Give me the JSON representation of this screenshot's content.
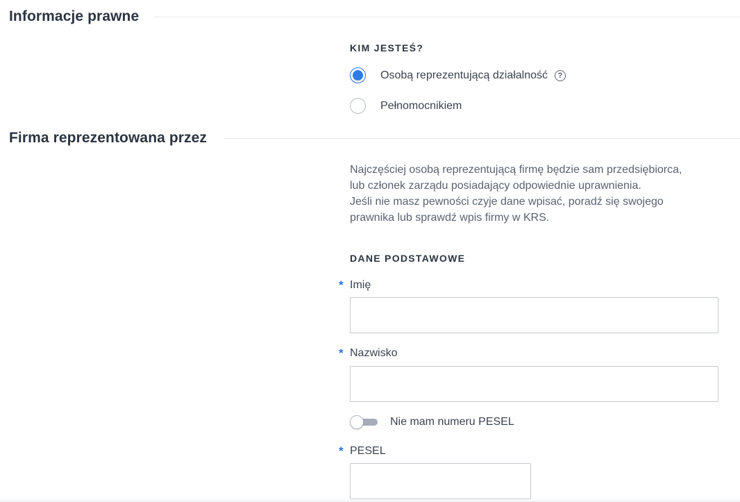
{
  "sections": {
    "legal_info_title": "Informacje prawne",
    "company_represented_title": "Firma reprezentowana przez"
  },
  "who_are_you": {
    "label": "KIM JESTEŚ?",
    "options": [
      {
        "label": "Osobą reprezentującą działalność",
        "checked": true,
        "help_icon": "question-circle-icon"
      },
      {
        "label": "Pełnomocnikiem",
        "checked": false
      }
    ]
  },
  "info_text": {
    "lines": [
      "Najczęściej osobą reprezentującą firmę będzie sam przedsiębiorca,",
      "lub członek zarządu posiadający odpowiednie uprawnienia.",
      "Jeśli nie masz pewności czyje dane wpisać, poradź się swojego",
      "prawnika lub sprawdź wpis firmy w KRS."
    ]
  },
  "basic_data": {
    "label": "DANE PODSTAWOWE",
    "required_marker": "*",
    "first_name": {
      "label": "Imię",
      "value": ""
    },
    "last_name": {
      "label": "Nazwisko",
      "value": ""
    },
    "no_pesel_toggle": {
      "label": "Nie mam numeru PESEL",
      "on": false
    },
    "pesel": {
      "label": "PESEL",
      "value": ""
    }
  },
  "colors": {
    "accent": "#2f7be8",
    "required": "#2f73e0",
    "title_text": "#2b3441",
    "body_text": "#5a6270",
    "border": "#c4c8cf"
  }
}
